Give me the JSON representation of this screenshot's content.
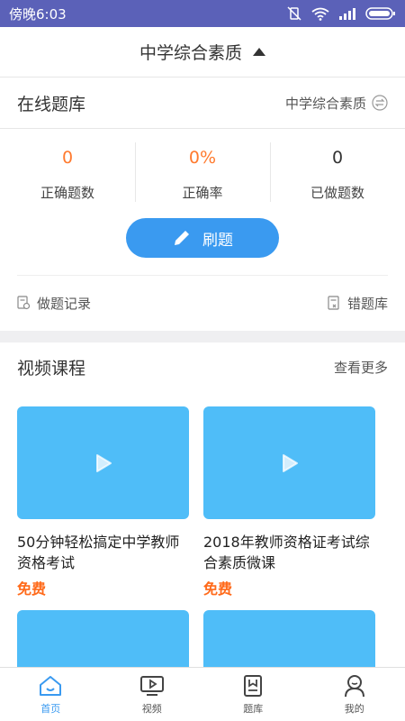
{
  "status_bar": {
    "time": "傍晚6:03"
  },
  "header": {
    "title": "中学综合素质"
  },
  "question_bank": {
    "title": "在线题库",
    "subject": "中学综合素质",
    "stats": [
      {
        "value": "0",
        "label": "正确题数"
      },
      {
        "value": "0%",
        "label": "正确率"
      },
      {
        "value": "0",
        "label": "已做题数"
      }
    ],
    "practice_button": "刷题",
    "history_link": "做题记录",
    "mistakes_link": "错题库"
  },
  "video_courses": {
    "title": "视频课程",
    "more": "查看更多",
    "items": [
      {
        "title": "50分钟轻松搞定中学教师资格考试",
        "price": "免费"
      },
      {
        "title": "2018年教师资格证考试综合素质微课",
        "price": "免费"
      }
    ]
  },
  "tabbar": {
    "tabs": [
      {
        "label": "首页",
        "icon": "home-icon"
      },
      {
        "label": "视频",
        "icon": "video-icon"
      },
      {
        "label": "题库",
        "icon": "question-bank-icon"
      },
      {
        "label": "我的",
        "icon": "profile-icon"
      }
    ]
  },
  "colors": {
    "accent": "#3a9af0",
    "orange": "#ff7a2e",
    "status_bar": "#5b61b8",
    "thumb": "#4fbdf8"
  }
}
